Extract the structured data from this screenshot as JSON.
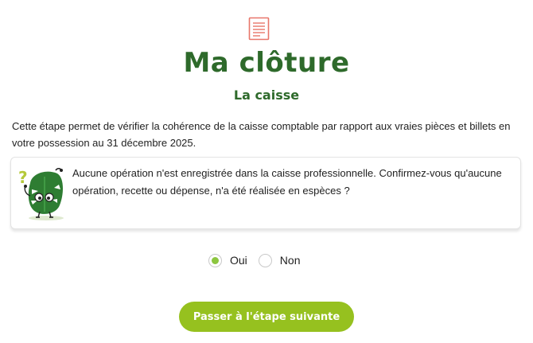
{
  "header": {
    "icon": "document-icon",
    "title": "Ma clôture",
    "subtitle": "La caisse"
  },
  "intro_text": "Cette étape permet de vérifier la cohérence de la caisse comptable par rapport aux vraies pièces et billets en votre possession au 31 décembre 2025.",
  "info_card": {
    "icon": "leaf-mascot-question-icon",
    "text": "Aucune opération n'est enregistrée dans la caisse professionnelle. Confirmez-vous qu'aucune opération, recette ou dépense, n'a été réalisée en espèces ?"
  },
  "answer": {
    "options": [
      {
        "label": "Oui",
        "selected": true
      },
      {
        "label": "Non",
        "selected": false
      }
    ]
  },
  "next_button": {
    "label": "Passer à l'étape suivante"
  },
  "colors": {
    "title_green": "#2e6a2b",
    "accent_green": "#96c11f",
    "icon_red": "#e8766a"
  }
}
